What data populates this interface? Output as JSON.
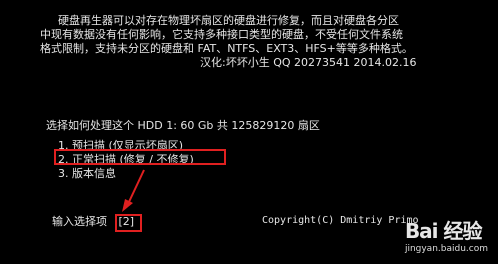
{
  "intro": {
    "line1": "硬盘再生器可以对存在物理坏扇区的硬盘进行修复，而且对硬盘各分区",
    "line2": "中现有数据没有任何影响，它支持多种接口类型的硬盘，不受任何文件系统",
    "line3": "格式限制，支持未分区的硬盘和 FAT、NTFS、EXT3、HFS+等等多种格式。",
    "line4": "汉化:坏坏小生 QQ 20273541  2014.02.16"
  },
  "disk_prompt": "选择如何处理这个 HDD 1: 60 Gb 共 125829120 扇区",
  "menu": [
    "1. 预扫描 (仅显示坏扇区)",
    "2. 正常扫描 (修复 / 不修复)",
    "3. 版本信息"
  ],
  "input": {
    "label": "输入选择项",
    "value": "[2]"
  },
  "copyright": "Copyright(C) Dmitriy Primo",
  "watermark": {
    "logo_text": "Bai 经验",
    "url": "jingyan.baidu.com"
  },
  "colors": {
    "background": "#000000",
    "text": "#e6e6e6",
    "annotation": "#e02020"
  }
}
